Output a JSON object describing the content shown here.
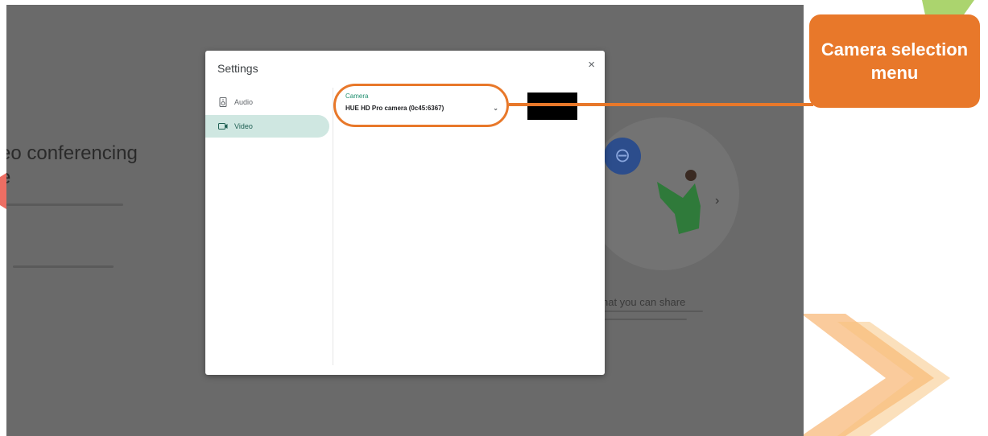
{
  "background": {
    "headline": "eo conferencing\ne",
    "share_title": "hat you can share",
    "next_arrow": "›",
    "link_icon": "⊖"
  },
  "dialog": {
    "title": "Settings",
    "close": "×",
    "nav": [
      {
        "label": "Audio",
        "icon": "speaker-icon",
        "active": false
      },
      {
        "label": "Video",
        "icon": "video-camera-icon",
        "active": true
      }
    ],
    "camera": {
      "label": "Camera",
      "selected": "HUE HD Pro camera (0c45:6367)",
      "chevron": "⌄"
    }
  },
  "callout": {
    "text": "Camera selection menu"
  },
  "colors": {
    "accent": "#e8782a",
    "overlay": "#6a6a6a",
    "active_nav": "#cfe7e1",
    "camera_label": "#1e8e6e"
  }
}
